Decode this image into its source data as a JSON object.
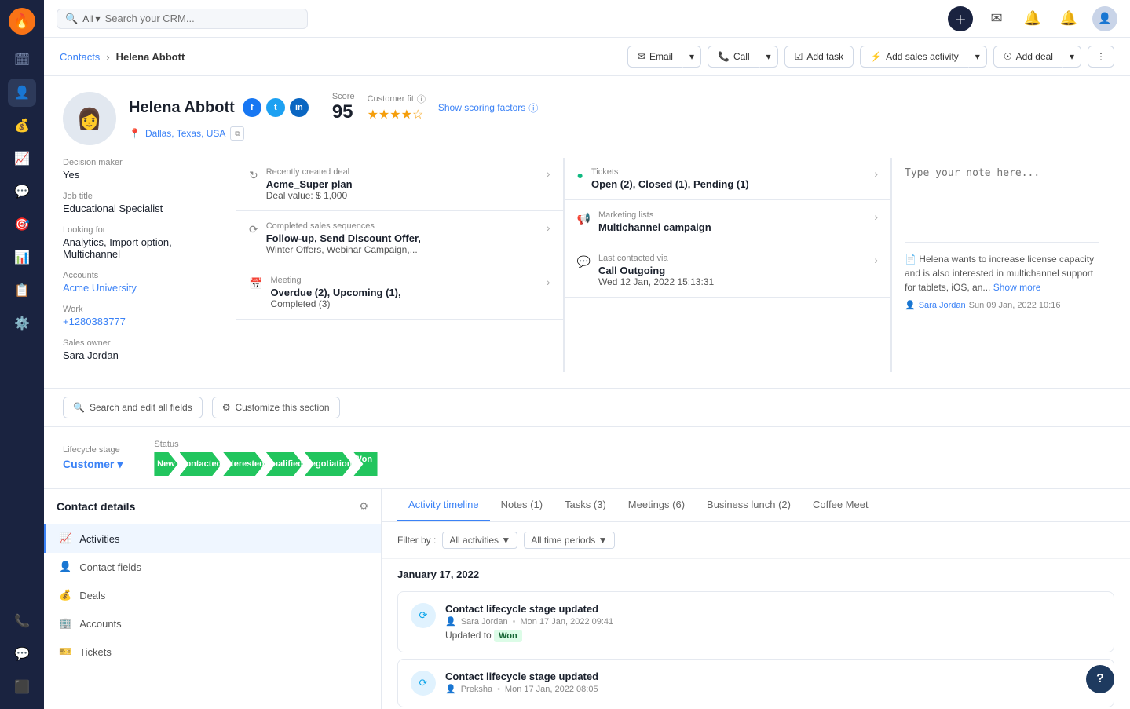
{
  "app": {
    "logo": "🔥",
    "search_placeholder": "Search your CRM...",
    "search_filter": "All"
  },
  "sidebar": {
    "items": [
      {
        "id": "home",
        "icon": "⊞",
        "active": false
      },
      {
        "id": "contacts",
        "icon": "👤",
        "active": true
      },
      {
        "id": "deals",
        "icon": "💰",
        "active": false
      },
      {
        "id": "activities",
        "icon": "📈",
        "active": false
      },
      {
        "id": "messages",
        "icon": "💬",
        "active": false
      },
      {
        "id": "goals",
        "icon": "🎯",
        "active": false
      },
      {
        "id": "reports",
        "icon": "📊",
        "active": false
      },
      {
        "id": "files",
        "icon": "📋",
        "active": false
      },
      {
        "id": "settings",
        "icon": "⚙️",
        "active": false
      },
      {
        "id": "phone",
        "icon": "📞",
        "active": false
      },
      {
        "id": "chat",
        "icon": "💬",
        "active": false
      },
      {
        "id": "apps",
        "icon": "⬛",
        "active": false
      }
    ]
  },
  "breadcrumb": {
    "parent": "Contacts",
    "current": "Helena Abbott"
  },
  "header_actions": {
    "email": "Email",
    "call": "Call",
    "add_task": "Add task",
    "add_sales_activity": "Add sales activity",
    "add_deal": "Add deal"
  },
  "profile": {
    "name": "Helena Abbott",
    "location": "Dallas, Texas, USA",
    "score_label": "Score",
    "score": "95",
    "customer_fit_label": "Customer fit",
    "stars": "★★★★☆",
    "show_scoring": "Show scoring factors",
    "decision_maker_label": "Decision maker",
    "decision_maker": "Yes",
    "job_title_label": "Job title",
    "job_title": "Educational Specialist",
    "looking_for_label": "Looking for",
    "looking_for": "Analytics, Import option, Multichannel",
    "accounts_label": "Accounts",
    "account": "Acme University",
    "work_label": "Work",
    "work_phone": "+1280383777",
    "sales_owner_label": "Sales owner",
    "sales_owner": "Sara Jordan"
  },
  "cards": [
    {
      "icon": "↻",
      "title": "Recently created deal",
      "main": "Acme_Super plan",
      "sub": "Deal value: $ 1,000"
    },
    {
      "icon": "✓",
      "title": "Tickets",
      "main": "Open (2), Closed (1), Pending (1)",
      "sub": ""
    },
    {
      "icon": "⟳",
      "title": "Completed sales sequences",
      "main": "Follow-up, Send Discount Offer,",
      "sub": "Winter Offers, Webinar Campaign,..."
    },
    {
      "icon": "📢",
      "title": "Marketing lists",
      "main": "Multichannel campaign",
      "sub": ""
    },
    {
      "icon": "📅",
      "title": "Meeting",
      "main": "Overdue (2), Upcoming (1),",
      "sub": "Completed (3)"
    },
    {
      "icon": "💬",
      "title": "Last contacted via",
      "main": "Call Outgoing",
      "sub": "Wed 12 Jan, 2022 15:13:31"
    }
  ],
  "note": {
    "placeholder": "Type your note here...",
    "content": "Helena wants to increase license capacity and is also interested in multichannel support for tablets, iOS, an...",
    "show_more": "Show more",
    "author": "Sara Jordan",
    "time": "Sun 09 Jan, 2022 10:16"
  },
  "action_bar": {
    "search_label": "Search and edit all fields",
    "customize_label": "Customize this section"
  },
  "lifecycle": {
    "lifecycle_label": "Lifecycle stage",
    "lifecycle_value": "Customer",
    "status_label": "Status",
    "stages": [
      {
        "label": "New",
        "active": true
      },
      {
        "label": "Contacted",
        "active": true
      },
      {
        "label": "Interested",
        "active": true
      },
      {
        "label": "Qualified",
        "active": true
      },
      {
        "label": "Negotiation",
        "active": true
      },
      {
        "label": "Won ▼",
        "active": true
      }
    ]
  },
  "left_panel": {
    "title": "Contact details",
    "nav_items": [
      {
        "id": "activities",
        "icon": "📈",
        "label": "Activities",
        "active": true
      },
      {
        "id": "contact-fields",
        "icon": "👤",
        "label": "Contact fields",
        "active": false
      },
      {
        "id": "deals",
        "icon": "💰",
        "label": "Deals",
        "active": false
      },
      {
        "id": "accounts",
        "icon": "🏢",
        "label": "Accounts",
        "active": false
      },
      {
        "id": "tickets",
        "icon": "🎫",
        "label": "Tickets",
        "active": false
      }
    ]
  },
  "right_panel": {
    "tabs": [
      {
        "label": "Activity timeline",
        "active": true
      },
      {
        "label": "Notes (1)",
        "active": false
      },
      {
        "label": "Tasks (3)",
        "active": false
      },
      {
        "label": "Meetings (6)",
        "active": false
      },
      {
        "label": "Business lunch (2)",
        "active": false
      },
      {
        "label": "Coffee Meet",
        "active": false
      }
    ],
    "filter_label": "Filter by :",
    "filter_activities": "All activities ▼",
    "filter_time": "All time periods ▼",
    "date_group": "January 17, 2022",
    "activities": [
      {
        "icon": "⟳",
        "title": "Contact lifecycle stage updated",
        "user": "Sara Jordan",
        "time": "Mon 17 Jan, 2022 09:41",
        "sub": "Updated to",
        "tag": "Won"
      },
      {
        "icon": "⟳",
        "title": "Contact lifecycle stage updated",
        "user": "Preksha",
        "time": "Mon 17 Jan, 2022 08:05",
        "sub": "",
        "tag": ""
      }
    ]
  }
}
